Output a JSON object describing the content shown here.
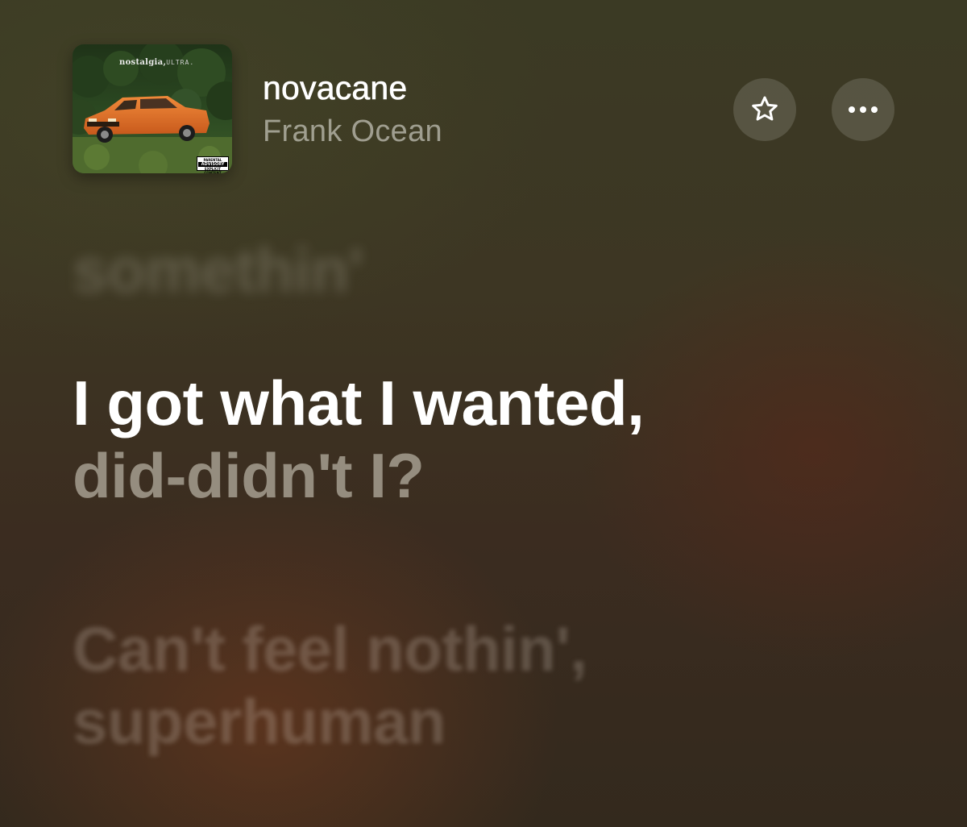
{
  "now_playing": {
    "album_art": {
      "album_text_bold": "nostalgia,",
      "album_text_thin": "ULTRA.",
      "advisory_line1": "PARENTAL",
      "advisory_line2": "ADVISORY",
      "advisory_line3": "EXPLICIT CONTENT"
    },
    "title": "novacane",
    "artist": "Frank Ocean",
    "favorite_icon": "star-outline-icon",
    "more_icon": "ellipsis-icon"
  },
  "lyrics": {
    "previous_line": "somethin'",
    "current_line_sung": "I got what I wanted,",
    "current_line_unsung": "did-didn't I?",
    "next_line_1": "Can't feel nothin',",
    "next_line_2": "superhuman"
  },
  "colors": {
    "background_top": "#3b3a24",
    "background_bottom": "#33291d",
    "text_active": "#ffffff",
    "car_orange": "#e0702a"
  }
}
